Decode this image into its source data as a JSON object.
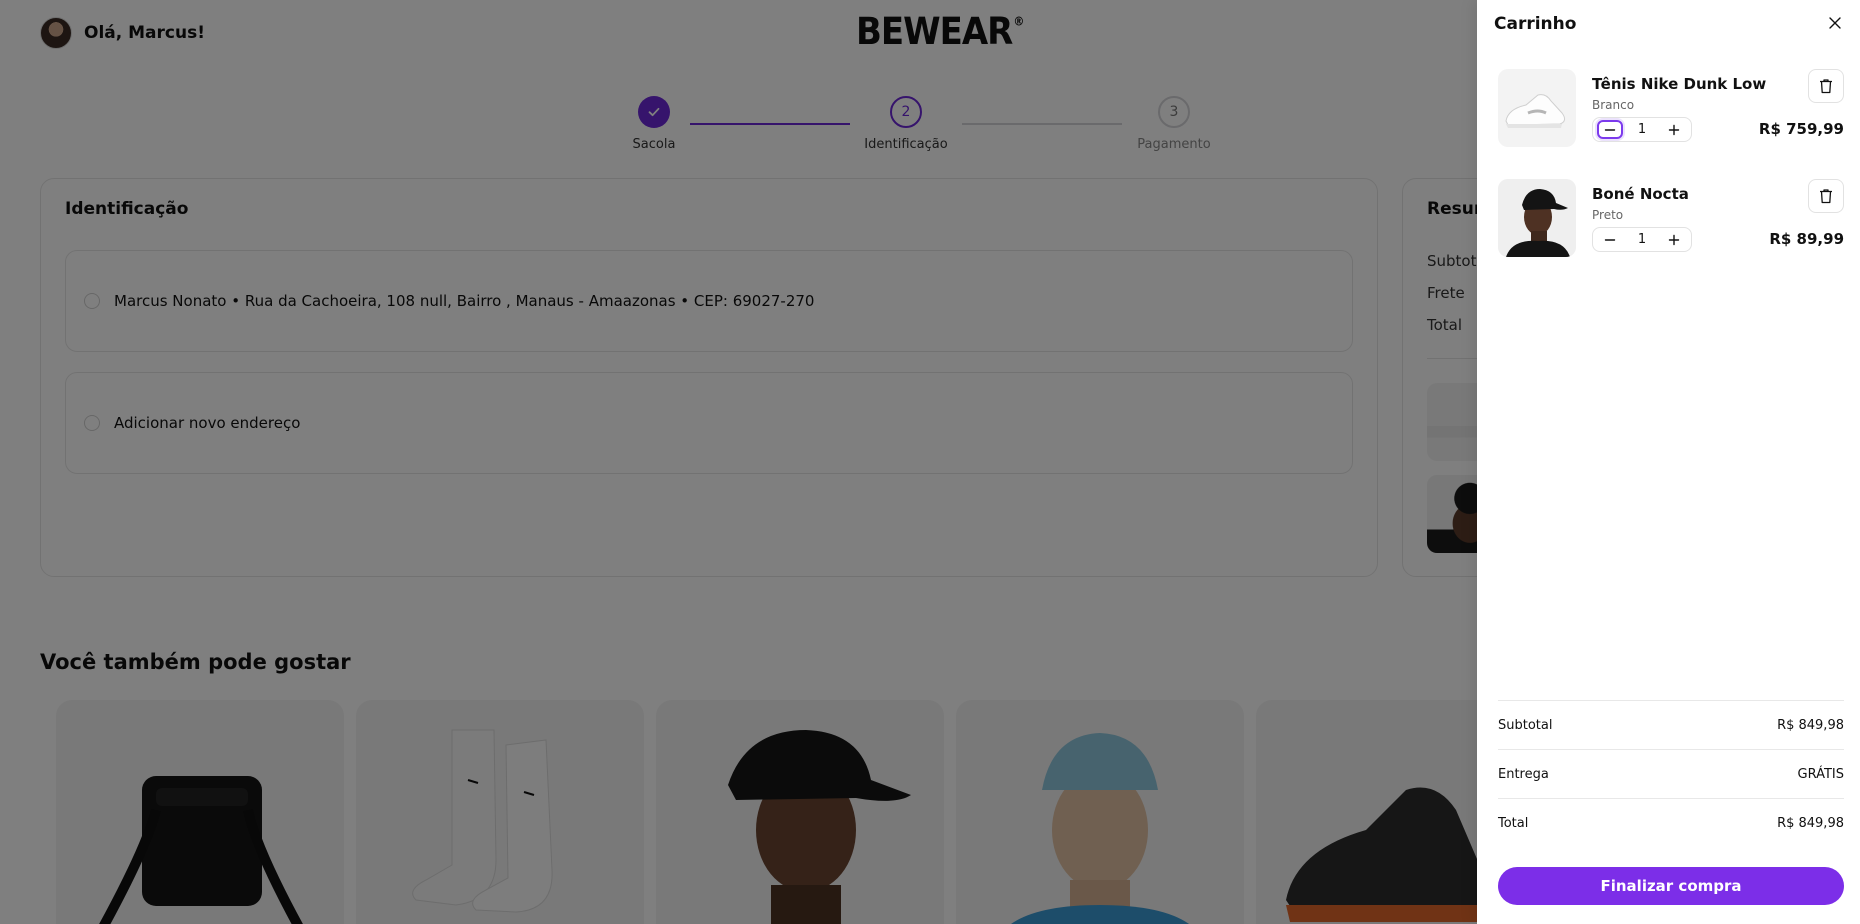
{
  "header": {
    "greeting": "Olá, Marcus!",
    "brand": "BEWEAR",
    "brand_mark": "®"
  },
  "stepper": {
    "steps": [
      {
        "label": "Sacola",
        "number": "1",
        "state": "done"
      },
      {
        "label": "Identificação",
        "number": "2",
        "state": "active"
      },
      {
        "label": "Pagamento",
        "number": "3",
        "state": "todo"
      }
    ],
    "accent": "#6d28d9"
  },
  "identification": {
    "title": "Identificação",
    "addresses": [
      {
        "text": "Marcus Nonato • Rua da Cachoeira, 108 null, Bairro , Manaus - Amaazonas • CEP: 69027-270"
      },
      {
        "text": "Adicionar novo endereço"
      }
    ]
  },
  "summary": {
    "title": "Resum",
    "rows": [
      "Subtotal",
      "Frete",
      "Total"
    ]
  },
  "recommendations": {
    "title": "Você também pode gostar"
  },
  "cart": {
    "title": "Carrinho",
    "items": [
      {
        "name": "Tênis Nike Dunk Low",
        "variant": "Branco",
        "quantity": "1",
        "price": "R$ 759,99"
      },
      {
        "name": "Boné Nocta",
        "variant": "Preto",
        "quantity": "1",
        "price": "R$ 89,99"
      }
    ],
    "subtotal_label": "Subtotal",
    "subtotal_value": "R$ 849,98",
    "delivery_label": "Entrega",
    "delivery_value": "GRÁTIS",
    "total_label": "Total",
    "total_value": "R$ 849,98",
    "checkout_label": "Finalizar compra",
    "accent": "#7c2ee8"
  },
  "icons": {
    "close": "close-icon",
    "trash": "trash-icon",
    "minus": "minus-icon",
    "plus": "plus-icon",
    "check": "check-icon"
  }
}
